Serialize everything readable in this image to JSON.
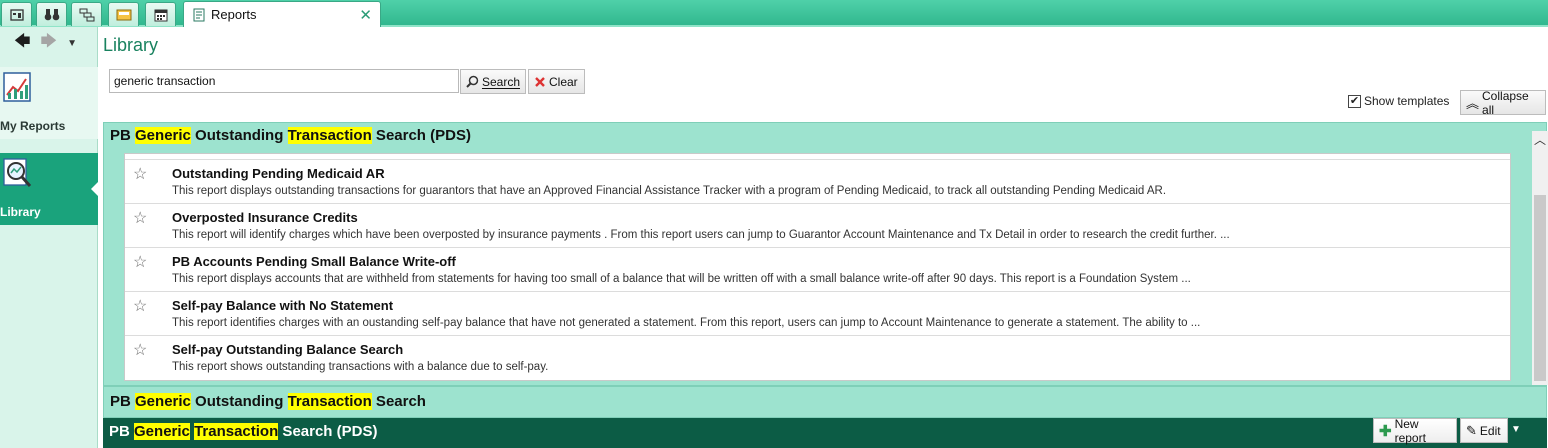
{
  "tabs": {
    "icons": [
      "dashboard-icon",
      "binoculars-icon",
      "hierarchy-icon",
      "inbox-icon",
      "calendar-icon"
    ],
    "active_label": "Reports",
    "close_glyph": "✕"
  },
  "nav": {
    "back_glyph": "🡄",
    "forward_glyph": "🡆",
    "dropdown_glyph": "▼",
    "items": [
      {
        "label": "My Reports",
        "icon": "chart-icon"
      },
      {
        "label": "Library",
        "icon": "magnifier-icon",
        "active": true
      }
    ]
  },
  "page": {
    "title": "Library"
  },
  "search": {
    "value": "generic transaction",
    "search_label": "Search",
    "clear_label": "Clear"
  },
  "options": {
    "show_templates_label": "Show templates",
    "show_templates_checked": true,
    "collapse_all_label": "Collapse all"
  },
  "groups": [
    {
      "title_parts": [
        "PB ",
        "Generic",
        " Outstanding ",
        "Transaction",
        " Search (PDS)"
      ],
      "reports": [
        {
          "title": "Outstanding Pending Medicaid AR",
          "description": "This report displays outstanding transactions for guarantors that have an Approved Financial Assistance Tracker with a program of Pending Medicaid, to track all outstanding Pending Medicaid AR."
        },
        {
          "title": "Overposted Insurance Credits",
          "description": "This report will identify charges which have been overposted by insurance payments . From this report users can jump to Guarantor Account Maintenance and Tx Detail in order to research the credit further. ..."
        },
        {
          "title": "PB Accounts Pending Small Balance Write-off",
          "description": "This report displays accounts that are withheld from statements for having too small of a balance that will be written off with a small balance write-off after 90 days. This report is a Foundation System ..."
        },
        {
          "title": "Self-pay Balance with No Statement",
          "description": "This report identifies charges with an oustanding self-pay balance that have not generated a statement. From this report, users can jump to Account Maintenance to generate a statement. The ability to ..."
        },
        {
          "title": "Self-pay Outstanding Balance Search",
          "description": "This report shows outstanding transactions with a balance due to self-pay."
        }
      ]
    },
    {
      "title_parts": [
        "PB ",
        "Generic",
        " Outstanding ",
        "Transaction",
        " Search"
      ]
    },
    {
      "title_parts": [
        "PB ",
        "Generic",
        " ",
        "Transaction",
        " Search (PDS)"
      ],
      "new_report_label": "New report",
      "edit_label": "Edit"
    }
  ],
  "colors": {
    "accent": "#19825f",
    "highlight": "#ffff00",
    "group_bg": "#9de3cf",
    "selected_group_bg": "#0c5c45"
  }
}
